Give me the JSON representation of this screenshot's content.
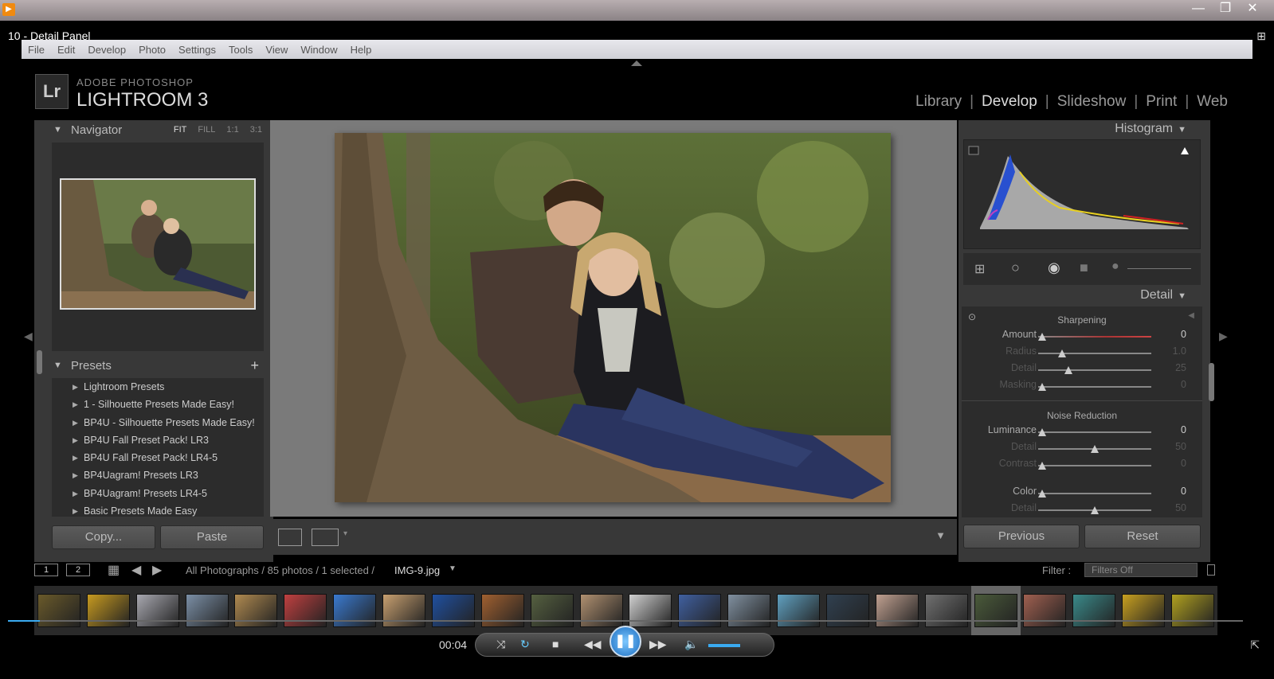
{
  "player": {
    "title": "10 - Detail Panel",
    "time": "00:04",
    "window_buttons": [
      "—",
      "❐",
      "✕"
    ]
  },
  "menu": [
    "File",
    "Edit",
    "Develop",
    "Photo",
    "Settings",
    "Tools",
    "View",
    "Window",
    "Help"
  ],
  "brand": {
    "badge": "Lr",
    "small": "ADOBE PHOTOSHOP",
    "big": "LIGHTROOM 3"
  },
  "modules": {
    "library": "Library",
    "develop": "Develop",
    "slideshow": "Slideshow",
    "print": "Print",
    "web": "Web"
  },
  "navigator": {
    "title": "Navigator",
    "zoom": [
      "FIT",
      "FILL",
      "1:1",
      "3:1"
    ]
  },
  "presets": {
    "title": "Presets",
    "items": [
      "Lightroom Presets",
      "1 - Silhouette Presets Made Easy!",
      "BP4U - Silhouette Presets Made Easy!",
      "BP4U Fall Preset Pack! LR3",
      "BP4U Fall Preset Pack! LR4-5",
      "BP4Uagram! Presets LR3",
      "BP4Uagram! Presets LR4-5",
      "Basic Presets Made Easy"
    ]
  },
  "left_buttons": {
    "copy": "Copy...",
    "paste": "Paste"
  },
  "right_panel": {
    "histogram_title": "Histogram",
    "detail_title": "Detail",
    "sharpening": {
      "title": "Sharpening",
      "rows": [
        {
          "label": "Amount",
          "value": "0",
          "dim": false
        },
        {
          "label": "Radius",
          "value": "1.0",
          "dim": true
        },
        {
          "label": "Detail",
          "value": "25",
          "dim": true
        },
        {
          "label": "Masking",
          "value": "0",
          "dim": true
        }
      ]
    },
    "noise": {
      "title": "Noise Reduction",
      "rows": [
        {
          "label": "Luminance",
          "value": "0",
          "dim": false
        },
        {
          "label": "Detail",
          "value": "50",
          "dim": true
        },
        {
          "label": "Contrast",
          "value": "0",
          "dim": true
        },
        {
          "label": "Color",
          "value": "0",
          "dim": false
        },
        {
          "label": "Detail",
          "value": "50",
          "dim": true
        }
      ]
    },
    "previous": "Previous",
    "reset": "Reset"
  },
  "filmstrip": {
    "screen1": "1",
    "screen2": "2",
    "path_prefix": "All Photographs / 85 photos / 1 selected /",
    "filename": "IMG-9.jpg",
    "filter_label": "Filter :",
    "filter_value": "Filters Off",
    "thumb_colors": [
      "#6a5a2a",
      "#c79a20",
      "#a8a8b0",
      "#7b8fa6",
      "#b08a50",
      "#c04040",
      "#3a7ad0",
      "#c8a070",
      "#2050a0",
      "#a06030",
      "#556040",
      "#b09070",
      "#d0d0d0",
      "#4060a0",
      "#8090a0",
      "#60a0c0",
      "#304050",
      "#c0a090",
      "#707070",
      "#4a5a3a",
      "#a06050",
      "#3a8a8a",
      "#c8a020",
      "#b0a020"
    ]
  }
}
